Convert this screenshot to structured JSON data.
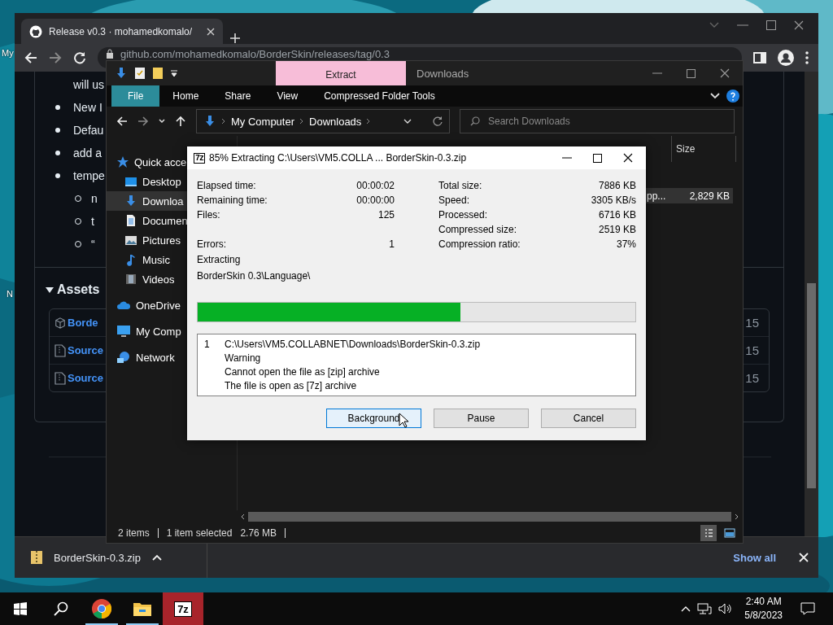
{
  "desktop": {
    "icon_labels": [
      "My",
      "N"
    ]
  },
  "browser": {
    "tab": {
      "title": "Release v0.3 · mohamedkomalo/"
    },
    "address": "github.com/mohamedkomalo/BorderSkin/releases/tag/0.3",
    "page": {
      "list": [
        {
          "kind": "continuation",
          "text": "will us"
        },
        {
          "kind": "bullet",
          "text": "New I"
        },
        {
          "kind": "bullet",
          "text": "Defau"
        },
        {
          "kind": "bullet",
          "text": "add a"
        },
        {
          "kind": "bullet",
          "text": "tempe"
        },
        {
          "kind": "sub_bullet",
          "text": "n"
        },
        {
          "kind": "sub_bullet",
          "text": "t"
        },
        {
          "kind": "sub_bullet",
          "text": "“"
        }
      ],
      "assets": {
        "title": "Assets",
        "expanded": true,
        "items": [
          {
            "kind": "package",
            "name": "Borde",
            "date": "15"
          },
          {
            "kind": "zip",
            "name": "Source",
            "date": "15"
          },
          {
            "kind": "zip",
            "name": "Source",
            "date": "15"
          }
        ]
      }
    },
    "downloads_bar": {
      "file": "BorderSkin-0.3.zip",
      "show_all": "Show all"
    }
  },
  "explorer": {
    "context_tab": "Extract",
    "title": "Downloads",
    "ribbon_tabs": [
      {
        "label": "File",
        "selected": true
      },
      {
        "label": "Home",
        "selected": false
      },
      {
        "label": "Share",
        "selected": false
      },
      {
        "label": "View",
        "selected": false
      },
      {
        "label": "Compressed Folder Tools",
        "selected": false
      }
    ],
    "breadcrumbs": [
      "My Computer",
      "Downloads"
    ],
    "search": {
      "placeholder": "Search Downloads"
    },
    "nav": [
      {
        "kind": "star",
        "label": "Quick acce",
        "selected": false,
        "children": [
          {
            "kind": "desktop",
            "label": "Desktop",
            "selected": false
          },
          {
            "kind": "download",
            "label": "Downloa",
            "selected": true
          },
          {
            "kind": "document",
            "label": "Documen",
            "selected": false
          },
          {
            "kind": "pictures",
            "label": "Pictures",
            "selected": false
          },
          {
            "kind": "music",
            "label": "Music",
            "selected": false
          },
          {
            "kind": "videos",
            "label": "Videos",
            "selected": false
          }
        ]
      },
      {
        "kind": "cloud",
        "label": "OneDrive",
        "selected": false
      },
      {
        "kind": "computer",
        "label": "My Comp",
        "selected": false
      },
      {
        "kind": "network",
        "label": "Network",
        "selected": false
      }
    ],
    "column_header": "Size",
    "row": {
      "name": "pp...",
      "size": "2,829 KB",
      "selected": true
    },
    "status": {
      "items": "2 items",
      "selection": "1 item selected",
      "size": "2.76 MB"
    }
  },
  "dialog": {
    "logo": "7z",
    "title": "85% Extracting C:\\Users\\VM5.COLLA ... BorderSkin-0.3.zip",
    "stats_left": [
      [
        {
          "label": "Elapsed time:",
          "value": "00:00:02"
        },
        {
          "label": "Remaining time:",
          "value": "00:00:00"
        },
        {
          "label": "Files:",
          "value": "125"
        }
      ],
      [
        {
          "label": "Errors:",
          "value": "1"
        }
      ]
    ],
    "stats_right": [
      {
        "label": "Total size:",
        "value": "7886 KB"
      },
      {
        "label": "Speed:",
        "value": "3305 KB/s"
      },
      {
        "label": "Processed:",
        "value": "6716 KB"
      },
      {
        "label": "Compressed size:",
        "value": "2519 KB"
      },
      {
        "label": "Compression ratio:",
        "value": "37%"
      }
    ],
    "status": "Extracting",
    "current_path": "BorderSkin 0.3\\Language\\",
    "progress": {
      "level": 0.6
    },
    "log": {
      "number": "1",
      "lines": [
        "C:\\Users\\VM5.COLLABNET\\Downloads\\BorderSkin-0.3.zip",
        "Warning",
        "Cannot open the file as [zip] archive",
        "The file is open as [7z] archive"
      ]
    },
    "buttons": [
      {
        "label": "Background",
        "focused": true
      },
      {
        "label": "Pause",
        "focused": false
      },
      {
        "label": "Cancel",
        "focused": false
      }
    ]
  },
  "taskbar": {
    "apps": [
      {
        "kind": "chrome",
        "active": false
      },
      {
        "kind": "explorer",
        "active": false
      },
      {
        "kind": "sevenzip",
        "label": "7z",
        "active": true
      }
    ],
    "time": "2:40 AM",
    "date": "5/8/2023"
  }
}
